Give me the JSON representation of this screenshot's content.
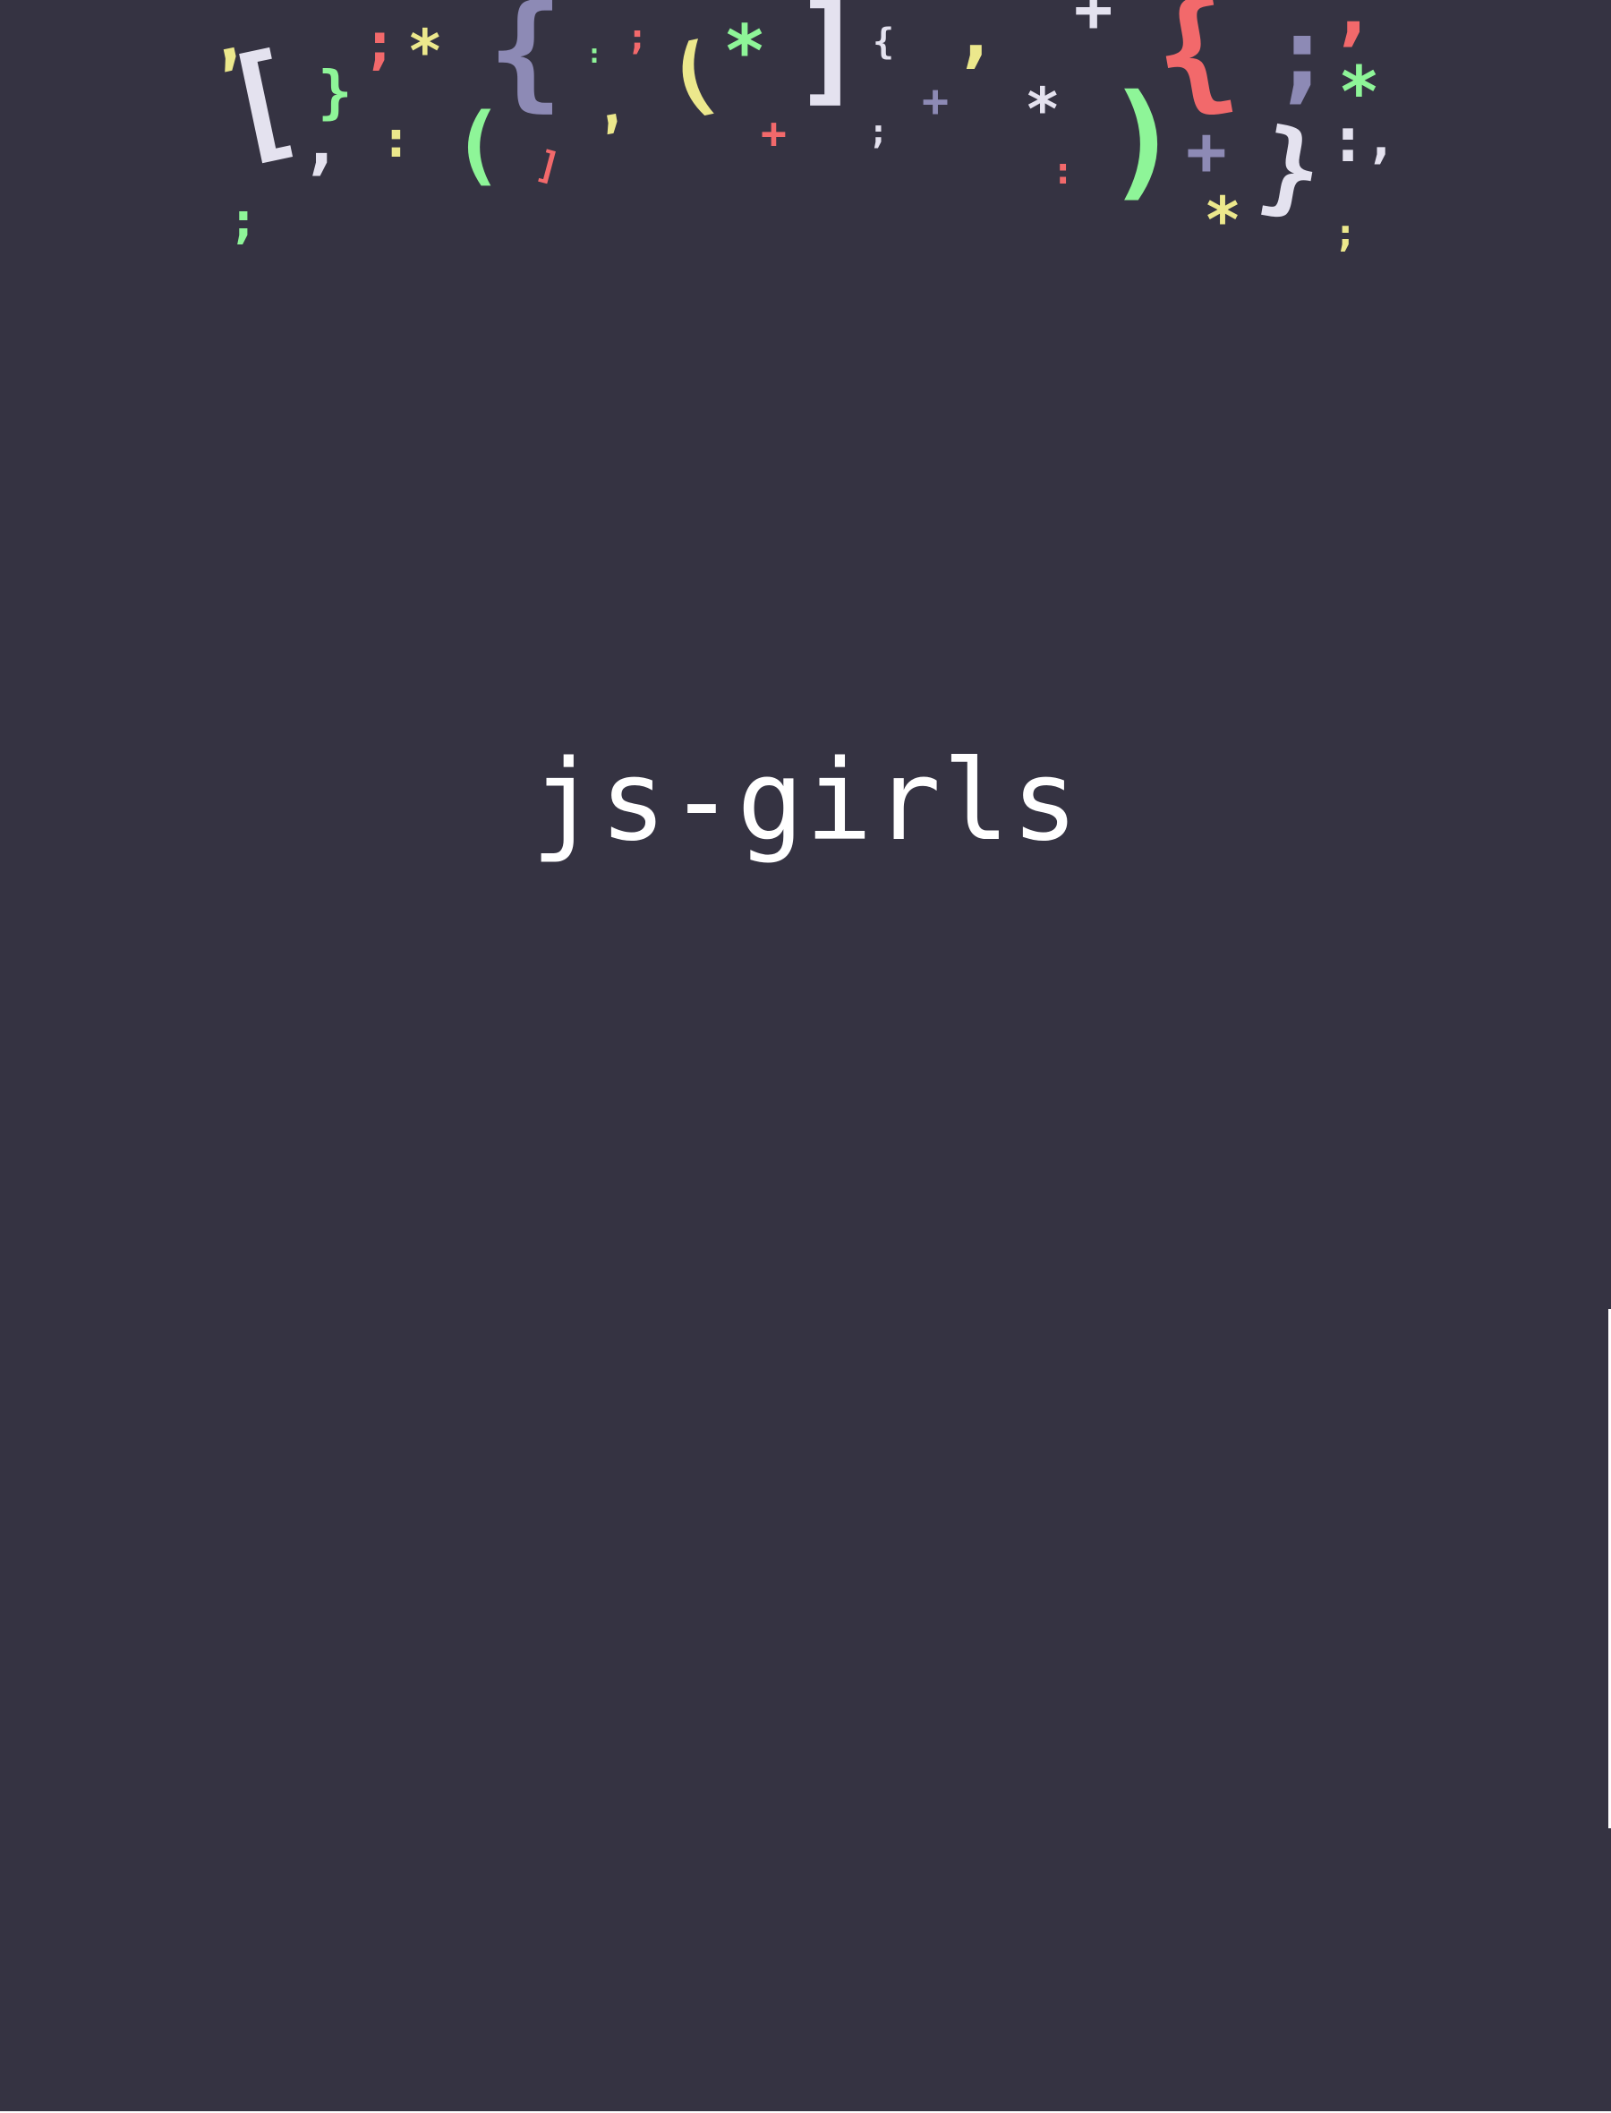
{
  "app": {
    "title": "js-girls"
  },
  "colors": {
    "background": "#353342",
    "title": "#ffffff",
    "yellow": "#ece88c",
    "red": "#f2696b",
    "green": "#8ef598",
    "lavender": "#8d8ab5",
    "white": "#e4e2ef"
  },
  "decoration": {
    "icon": "punctuation-confetti",
    "glyphs": [
      ",",
      "[",
      "}",
      ";",
      "*",
      "{",
      ":",
      ";",
      ",",
      "(",
      "*",
      "]",
      "{",
      ",",
      "+",
      "*",
      ")",
      "{",
      ";",
      "*",
      "}",
      "+",
      ",",
      "(",
      ":",
      "]",
      "+",
      ";",
      "*",
      ":",
      ";",
      ","
    ]
  }
}
